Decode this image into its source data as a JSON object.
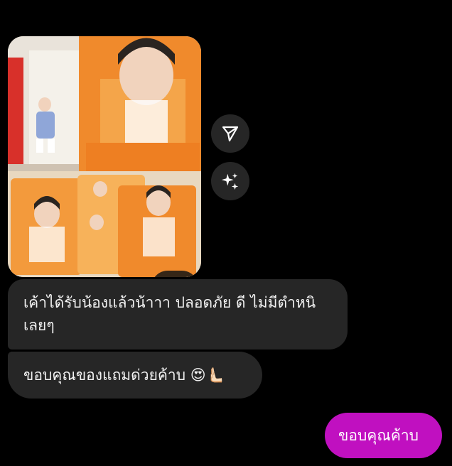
{
  "conversation": {
    "photo_message": {
      "icon": "photo-of-cards-and-standees",
      "ai_badge_icon": "sparkles-icon"
    },
    "side_actions": [
      {
        "icon": "send-icon"
      },
      {
        "icon": "sparkles-icon"
      }
    ],
    "messages": [
      {
        "sender": "them",
        "text": "เค้าได้รับน้องแล้วน้าาา ปลอดภัย ดี ไม่มีตำหนิเลยๆ"
      },
      {
        "sender": "them",
        "text": "ขอบคุณของแถมด่วยค้าบ 😍🫷🏻"
      },
      {
        "sender": "me",
        "text": "ขอบคุณค้าบ"
      }
    ]
  },
  "colors": {
    "background": "#000000",
    "incoming_bubble": "#262626",
    "outgoing_bubble": "#c010c0"
  }
}
